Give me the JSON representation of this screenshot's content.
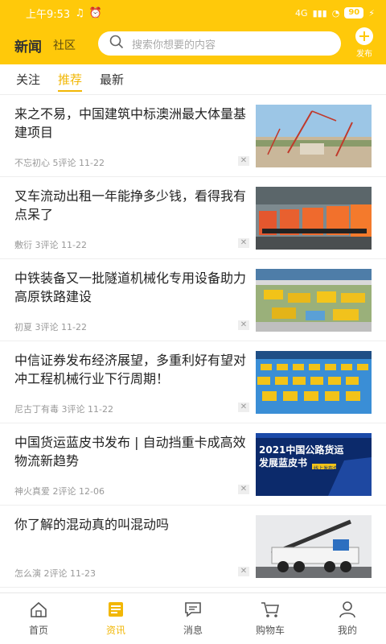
{
  "status": {
    "time": "上午9:53",
    "battery": "90",
    "network": "4G"
  },
  "header": {
    "title": "新闻",
    "subtitle": "社区",
    "search_placeholder": "搜索你想要的内容",
    "publish_label": "发布"
  },
  "tabs": [
    {
      "label": "关注",
      "active": false
    },
    {
      "label": "推荐",
      "active": true
    },
    {
      "label": "最新",
      "active": false
    }
  ],
  "feed": [
    {
      "title": "来之不易，中国建筑中标澳洲最大体量基建项目",
      "meta": "不忘初心 5评论 11-22"
    },
    {
      "title": "叉车流动出租一年能挣多少钱，看得我有点呆了",
      "meta": "敷衍 3评论 11-22"
    },
    {
      "title": "中铁装备又一批隧道机械化专用设备助力高原铁路建设",
      "meta": "初夏 3评论 11-22"
    },
    {
      "title": "中信证券发布经济展望，多重利好有望对冲工程机械行业下行周期！",
      "meta": "尼古丁有毒 3评论 11-22"
    },
    {
      "title": "中国货运蓝皮书发布 | 自动挡重卡成高效物流新趋势",
      "meta": "神火真爱 2评论 12-06"
    },
    {
      "title": "你了解的混动真的叫混动吗",
      "meta": "怎么演 2评论 11-23"
    }
  ],
  "thumb_texts": {
    "bluebook_title": "2021中国公路货运",
    "bluebook_sub": "发展蓝皮书",
    "bluebook_tag": "线上发布会"
  },
  "nav": [
    {
      "label": "首页",
      "icon": "home-icon",
      "active": false
    },
    {
      "label": "资讯",
      "icon": "news-icon",
      "active": true
    },
    {
      "label": "消息",
      "icon": "message-icon",
      "active": false
    },
    {
      "label": "购物车",
      "icon": "cart-icon",
      "active": false
    },
    {
      "label": "我的",
      "icon": "user-icon",
      "active": false
    }
  ],
  "colors": {
    "brand": "#FFC90A",
    "active": "#F2B705"
  }
}
